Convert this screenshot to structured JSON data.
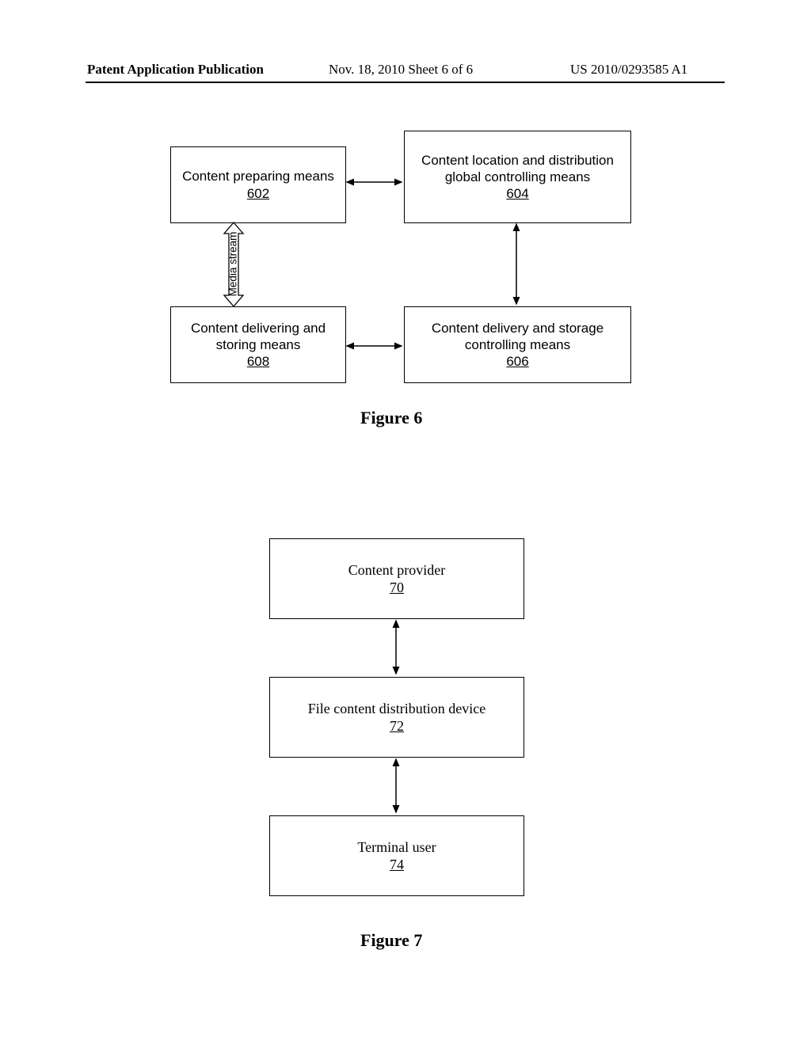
{
  "header": {
    "left": "Patent Application Publication",
    "center": "Nov. 18, 2010  Sheet 6 of 6",
    "right": "US 2010/0293585 A1"
  },
  "fig6": {
    "box602": {
      "label": "Content preparing means",
      "ref": "602"
    },
    "box604": {
      "label": "Content location and distribution global controlling means",
      "ref": "604"
    },
    "box606": {
      "label": "Content delivery and storage controlling means",
      "ref": "606"
    },
    "box608": {
      "label": "Content delivering and storing means",
      "ref": "608"
    },
    "streamLabel": "Media stream",
    "caption": "Figure 6"
  },
  "fig7": {
    "box70": {
      "label": "Content provider",
      "ref": "70"
    },
    "box72": {
      "label": "File content distribution device",
      "ref": "72"
    },
    "box74": {
      "label": "Terminal user",
      "ref": "74"
    },
    "caption": "Figure 7"
  }
}
